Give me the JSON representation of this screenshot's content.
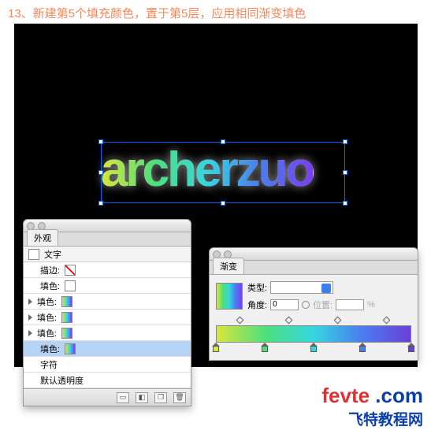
{
  "caption": "13、新建第5个填充颜色，置于第5层，应用相同渐变填色",
  "banner_text": "archerzuo",
  "appearance": {
    "tab": "外观",
    "text_label": "文字",
    "rows": [
      {
        "label": "描边:",
        "swatch": "none",
        "tri": false
      },
      {
        "label": "填色:",
        "swatch": "white",
        "tri": false
      },
      {
        "label": "填色:",
        "swatch": "grad",
        "tri": true
      },
      {
        "label": "填色:",
        "swatch": "grad",
        "tri": true
      },
      {
        "label": "填色:",
        "swatch": "grad",
        "tri": true
      },
      {
        "label": "填色:",
        "swatch": "grad",
        "tri": false,
        "selected": true
      },
      {
        "label": "字符",
        "swatch": "",
        "tri": false
      },
      {
        "label": "默认透明度",
        "swatch": "",
        "tri": false
      }
    ]
  },
  "gradient": {
    "tab": "渐变",
    "type_label": "类型:",
    "angle_label": "角度:",
    "angle_value": "0",
    "position_label": "位置:",
    "position_unit": "%",
    "stops": [
      {
        "pct": 0,
        "color": "#d9e63a"
      },
      {
        "pct": 25,
        "color": "#4de07a"
      },
      {
        "pct": 50,
        "color": "#35d6e0"
      },
      {
        "pct": 75,
        "color": "#4a7df0"
      },
      {
        "pct": 100,
        "color": "#6b3fd8"
      }
    ],
    "diamonds": [
      12,
      37,
      62,
      87
    ]
  },
  "watermark": {
    "line1_a": "fevte",
    "line1_b": " .com",
    "line2": "飞特教程网"
  }
}
